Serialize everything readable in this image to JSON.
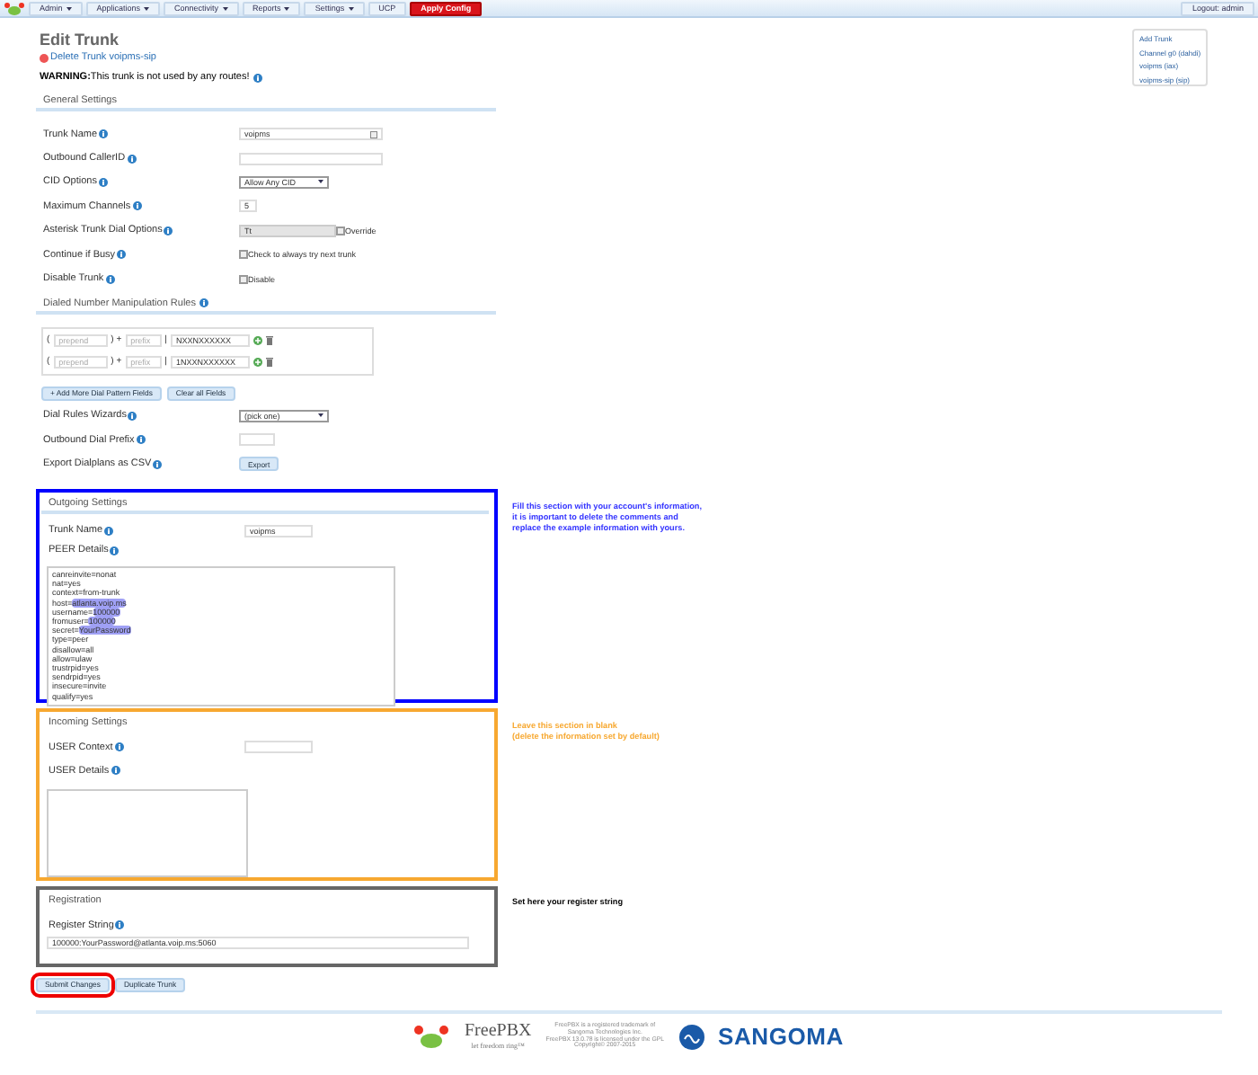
{
  "nav": {
    "items": [
      {
        "label": "Admin",
        "caret": true
      },
      {
        "label": "Applications",
        "caret": true
      },
      {
        "label": "Connectivity",
        "caret": true
      },
      {
        "label": "Reports",
        "caret": true
      },
      {
        "label": "Settings",
        "caret": true
      },
      {
        "label": "UCP",
        "caret": false
      }
    ],
    "apply": "Apply Config",
    "logout": "Logout: admin"
  },
  "title": "Edit Trunk",
  "delete_link": "Delete Trunk voipms-sip",
  "warning": {
    "label": "WARNING:",
    "text": "This trunk is not used by any routes!"
  },
  "general": {
    "heading": "General Settings",
    "fields": [
      {
        "kind": "text",
        "label": "Trunk Name",
        "value": "voipms",
        "icon": true
      },
      {
        "kind": "text",
        "label": "Outbound CallerID",
        "icon": false
      },
      {
        "kind": "select",
        "label": "CID Options",
        "value": "Allow Any CID"
      },
      {
        "kind": "short_text",
        "label": "Maximum Channels",
        "value": "5",
        "icon": false
      },
      {
        "kind": "dial_options",
        "label": "Asterisk Trunk Dial Options",
        "value": "Tt",
        "checkbox": "Override",
        "checked": false
      },
      {
        "kind": "checkbox",
        "label": "Continue if Busy",
        "checkbox": "Check to always try next trunk",
        "checked": false
      },
      {
        "kind": "checkbox",
        "label": "Disable Trunk",
        "checkbox": "Disable",
        "checked": false
      }
    ]
  },
  "dial_rules": {
    "heading": "Dialed Number Manipulation Rules",
    "rules": [
      {
        "open": "(",
        "prepend_placeholder": "prepend",
        "plus": ") +",
        "prefix_placeholder": "prefix",
        "pipe": "|",
        "pattern": "NXXNXXXXXX"
      },
      {
        "open": "(",
        "prepend_placeholder": "prepend",
        "plus": ") +",
        "prefix_placeholder": "prefix",
        "pipe": "|",
        "pattern": "1NXXNXXXXXX"
      }
    ],
    "buttons": [
      "+ Add More Dial Pattern Fields",
      "Clear all Fields"
    ],
    "fields": [
      {
        "kind": "select",
        "label": "Dial Rules Wizards",
        "value": "(pick one)"
      },
      {
        "kind": "prefix_text",
        "label": "Outbound Dial Prefix"
      },
      {
        "kind": "button",
        "label": "Export Dialplans as CSV",
        "value": "Export"
      }
    ]
  },
  "sections": [
    {
      "kind": "outgoing",
      "heading": "Outgoing Settings",
      "color": "#0000ff",
      "trunk_label": "Trunk Name",
      "trunk_value": "voipms",
      "details_label": "PEER Details",
      "details": [
        {
          "key": "canreinvite=",
          "value": "nonat",
          "highlighted": false
        },
        {
          "key": "nat=",
          "value": "yes",
          "highlighted": false
        },
        {
          "key": "context=",
          "value": "from-trunk",
          "highlighted": false
        },
        {
          "key": "host=",
          "value": "atlanta.voip.ms",
          "highlighted": true
        },
        {
          "key": "username=",
          "value": "100000",
          "highlighted": true
        },
        {
          "key": "fromuser=",
          "value": "100000",
          "highlighted": true
        },
        {
          "key": "secret=",
          "value": "YourPassword",
          "highlighted": true
        },
        {
          "key": "type=",
          "value": "peer",
          "highlighted": false
        },
        {
          "key": "disallow=",
          "value": "all",
          "highlighted": false
        },
        {
          "key": "allow=",
          "value": "ulaw",
          "highlighted": false
        },
        {
          "key": "trustrpid=",
          "value": "yes",
          "highlighted": false
        },
        {
          "key": "sendrpid=",
          "value": "yes",
          "highlighted": false
        },
        {
          "key": "insecure=",
          "value": "invite",
          "highlighted": false
        },
        {
          "key": "qualify=",
          "value": "yes",
          "highlighted": false
        }
      ],
      "note": {
        "lines": [
          "Fill this section with your account's information,",
          "it is important to delete the comments and",
          "replace the example information with yours."
        ],
        "color": "#3333ff"
      }
    },
    {
      "kind": "incoming",
      "heading": "Incoming Settings",
      "color": "#f7a830",
      "context_label": "USER Context",
      "details_label": "USER Details",
      "note": {
        "lines": [
          "Leave this section in blank",
          "(delete the information set by default)"
        ],
        "color": "#f7a830"
      }
    },
    {
      "kind": "registration",
      "heading": "Registration",
      "color": "#666666",
      "register_label": "Register String",
      "register_value": "100000:YourPassword@atlanta.voip.ms:5060",
      "note": {
        "lines": [
          "Set here your register string"
        ],
        "color": "#000000"
      }
    }
  ],
  "actions": [
    {
      "label": "Submit Changes",
      "highlighted": true
    },
    {
      "label": "Duplicate Trunk",
      "highlighted": false
    }
  ],
  "side_menu": [
    "Add Trunk",
    "Channel g0 (dahdi)",
    "voipms (iax)",
    "voipms-sip (sip)"
  ],
  "footer": {
    "freepbx": "FreePBX",
    "tagline": "let freedom ring™",
    "legal": [
      "FreePBX is a registered trademark of",
      "Sangoma Technologies Inc.",
      "FreePBX 13.0.78 is licensed under the GPL",
      "Copyright© 2007-2015"
    ],
    "sangoma": "SANGOMA"
  }
}
